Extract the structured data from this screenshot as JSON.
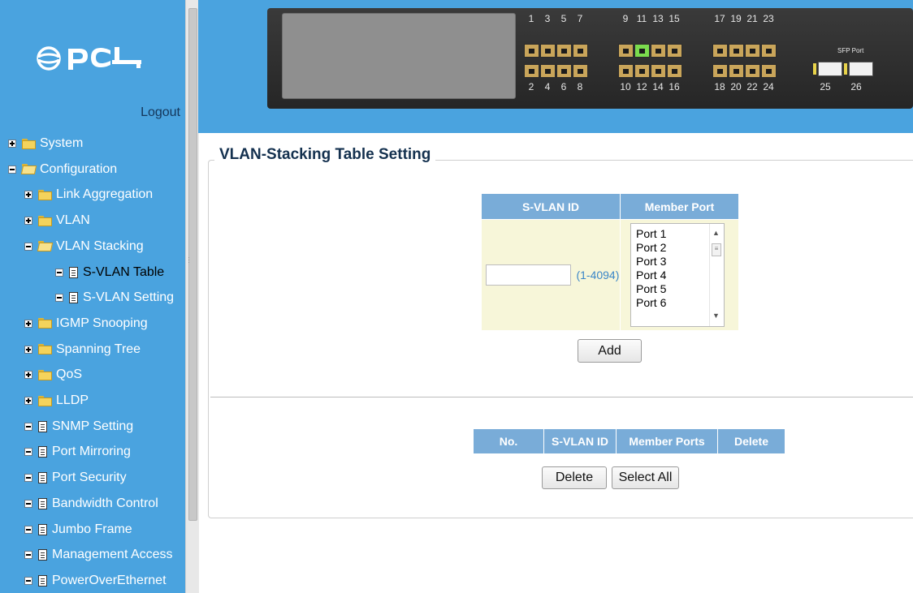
{
  "brand": {
    "logo_text": "PCI"
  },
  "sidebar": {
    "logout_label": "Logout",
    "items": [
      {
        "label": "System",
        "expander": "plus",
        "icon": "folder",
        "level": 0
      },
      {
        "label": "Configuration",
        "expander": "minus",
        "icon": "folder-open",
        "level": 0
      },
      {
        "label": "Link Aggregation",
        "expander": "plus",
        "icon": "folder",
        "level": 1
      },
      {
        "label": "VLAN",
        "expander": "plus",
        "icon": "folder",
        "level": 1
      },
      {
        "label": "VLAN Stacking",
        "expander": "minus",
        "icon": "folder-open",
        "level": 1
      },
      {
        "label": "S-VLAN Table",
        "expander": "minus",
        "icon": "document",
        "level": 2,
        "selected": true
      },
      {
        "label": "S-VLAN Setting",
        "expander": "minus",
        "icon": "document",
        "level": 2
      },
      {
        "label": "IGMP Snooping",
        "expander": "plus",
        "icon": "folder",
        "level": 1
      },
      {
        "label": "Spanning Tree",
        "expander": "plus",
        "icon": "folder",
        "level": 1
      },
      {
        "label": "QoS",
        "expander": "plus",
        "icon": "folder",
        "level": 1
      },
      {
        "label": "LLDP",
        "expander": "plus",
        "icon": "folder",
        "level": 1
      },
      {
        "label": "SNMP Setting",
        "expander": "minus",
        "icon": "document",
        "level": 1
      },
      {
        "label": "Port Mirroring",
        "expander": "minus",
        "icon": "document",
        "level": 1
      },
      {
        "label": "Port Security",
        "expander": "minus",
        "icon": "document",
        "level": 1
      },
      {
        "label": "Bandwidth Control",
        "expander": "minus",
        "icon": "document",
        "level": 1
      },
      {
        "label": "Jumbo Frame",
        "expander": "minus",
        "icon": "document",
        "level": 1
      },
      {
        "label": "Management Access",
        "expander": "minus",
        "icon": "document",
        "level": 1
      },
      {
        "label": "PowerOverEthernet",
        "expander": "minus",
        "icon": "document",
        "level": 1
      }
    ]
  },
  "switch_panel": {
    "top_ports": [
      "1",
      "3",
      "5",
      "7",
      "9",
      "11",
      "13",
      "15",
      "17",
      "19",
      "21",
      "23"
    ],
    "bottom_ports": [
      "2",
      "4",
      "6",
      "8",
      "10",
      "12",
      "14",
      "16",
      "18",
      "20",
      "22",
      "24"
    ],
    "active_port": "11",
    "sfp_label": "SFP Port",
    "sfp_ports": [
      "25",
      "26"
    ]
  },
  "main": {
    "section_title": "VLAN-Stacking Table Setting",
    "form": {
      "col_svlan": "S-VLAN ID",
      "col_member": "Member Port",
      "svlan_value": "",
      "svlan_range": "(1-4094)",
      "member_options": [
        "Port 1",
        "Port 2",
        "Port 3",
        "Port 4",
        "Port 5",
        "Port 6"
      ],
      "add_label": "Add"
    },
    "list": {
      "headers": [
        "No.",
        "S-VLAN ID",
        "Member Ports",
        "Delete"
      ],
      "rows": [],
      "delete_label": "Delete",
      "select_all_label": "Select All"
    }
  },
  "colors": {
    "sidebar_bg": "#4aa3df",
    "table_header": "#79acd8",
    "form_cell": "#f7f6d9",
    "title_text": "#14314f"
  }
}
